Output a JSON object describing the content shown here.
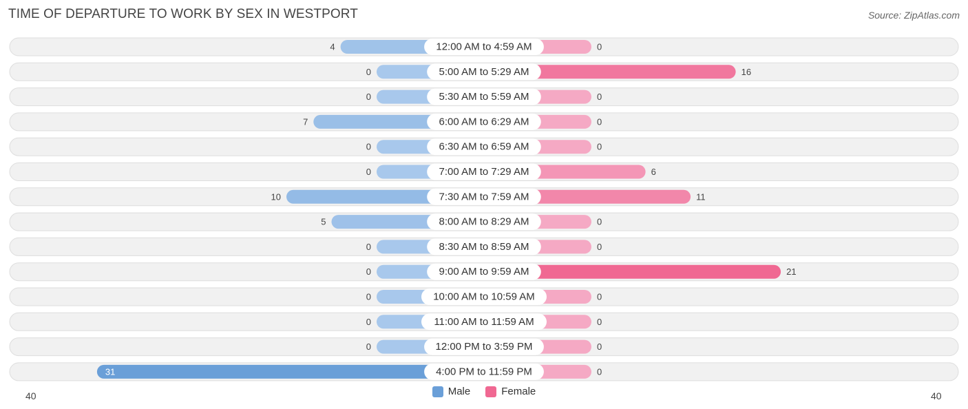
{
  "header": {
    "title": "TIME OF DEPARTURE TO WORK BY SEX IN WESTPORT",
    "source": "Source: ZipAtlas.com"
  },
  "colors": {
    "male_light": "#a8c8ec",
    "male_strong": "#6a9fd8",
    "female_light": "#f5a9c4",
    "female_strong": "#f06892"
  },
  "legend": {
    "male_label": "Male",
    "female_label": "Female",
    "male_color": "#6a9fd8",
    "female_color": "#f06892"
  },
  "chart_data": {
    "type": "bar",
    "orientation": "horizontal-diverging",
    "title": "TIME OF DEPARTURE TO WORK BY SEX IN WESTPORT",
    "categories": [
      "12:00 AM to 4:59 AM",
      "5:00 AM to 5:29 AM",
      "5:30 AM to 5:59 AM",
      "6:00 AM to 6:29 AM",
      "6:30 AM to 6:59 AM",
      "7:00 AM to 7:29 AM",
      "7:30 AM to 7:59 AM",
      "8:00 AM to 8:29 AM",
      "8:30 AM to 8:59 AM",
      "9:00 AM to 9:59 AM",
      "10:00 AM to 10:59 AM",
      "11:00 AM to 11:59 AM",
      "12:00 PM to 3:59 PM",
      "4:00 PM to 11:59 PM"
    ],
    "series": [
      {
        "name": "Male",
        "values": [
          4,
          0,
          0,
          7,
          0,
          0,
          10,
          5,
          0,
          0,
          0,
          0,
          0,
          31
        ]
      },
      {
        "name": "Female",
        "values": [
          0,
          16,
          0,
          0,
          0,
          6,
          11,
          0,
          0,
          21,
          0,
          0,
          0,
          0
        ]
      }
    ],
    "axis": {
      "left_label": "40",
      "right_label": "40",
      "range": [
        -40,
        40
      ]
    },
    "legend_position": "bottom-center",
    "grid": false
  }
}
